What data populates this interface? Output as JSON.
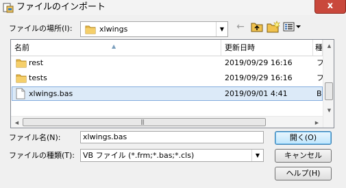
{
  "window": {
    "title": "ファイルのインポート",
    "close_label": "x"
  },
  "location": {
    "label": "ファイルの場所(I):",
    "value": "xlwings"
  },
  "columns": [
    {
      "label": "名前"
    },
    {
      "label": "更新日時"
    },
    {
      "label": "種"
    }
  ],
  "files": [
    {
      "name": "rest",
      "date": "2019/09/29 16:16",
      "type": "フ",
      "kind": "folder"
    },
    {
      "name": "tests",
      "date": "2019/09/29 16:16",
      "type": "フ",
      "kind": "folder"
    },
    {
      "name": "xlwings.bas",
      "date": "2019/09/01 4:41",
      "type": "B",
      "kind": "file",
      "selected": true
    }
  ],
  "filename": {
    "label": "ファイル名(N):",
    "value": "xlwings.bas"
  },
  "filetype": {
    "label": "ファイルの種類(T):",
    "value": "VB ファイル (*.frm;*.bas;*.cls)"
  },
  "buttons": {
    "open": "開く(O)",
    "cancel": "キャンセル",
    "help": "ヘルプ(H)"
  },
  "colors": {
    "selected_row": "#dceaf8",
    "close_button": "#c9483c",
    "folder": "#e8b84a"
  }
}
